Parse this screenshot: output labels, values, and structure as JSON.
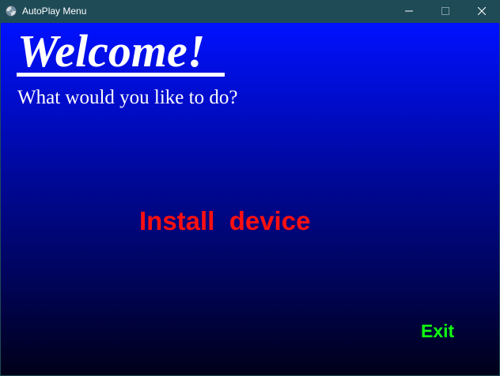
{
  "window": {
    "title": "AutoPlay Menu",
    "icons": {
      "app": "cd-disc-icon",
      "minimize": "minimize-icon",
      "maximize": "maximize-icon",
      "close": "close-icon"
    }
  },
  "menu": {
    "welcome": "Welcome!",
    "prompt": "What would you like to do?",
    "install_label": "Install  device",
    "exit_label": "Exit"
  },
  "colors": {
    "titlebar": "#1f4b57",
    "gradient_top": "#0011ff",
    "gradient_bottom": "#000018",
    "install": "#ff1010",
    "exit": "#10ff10",
    "text": "#ffffff"
  }
}
